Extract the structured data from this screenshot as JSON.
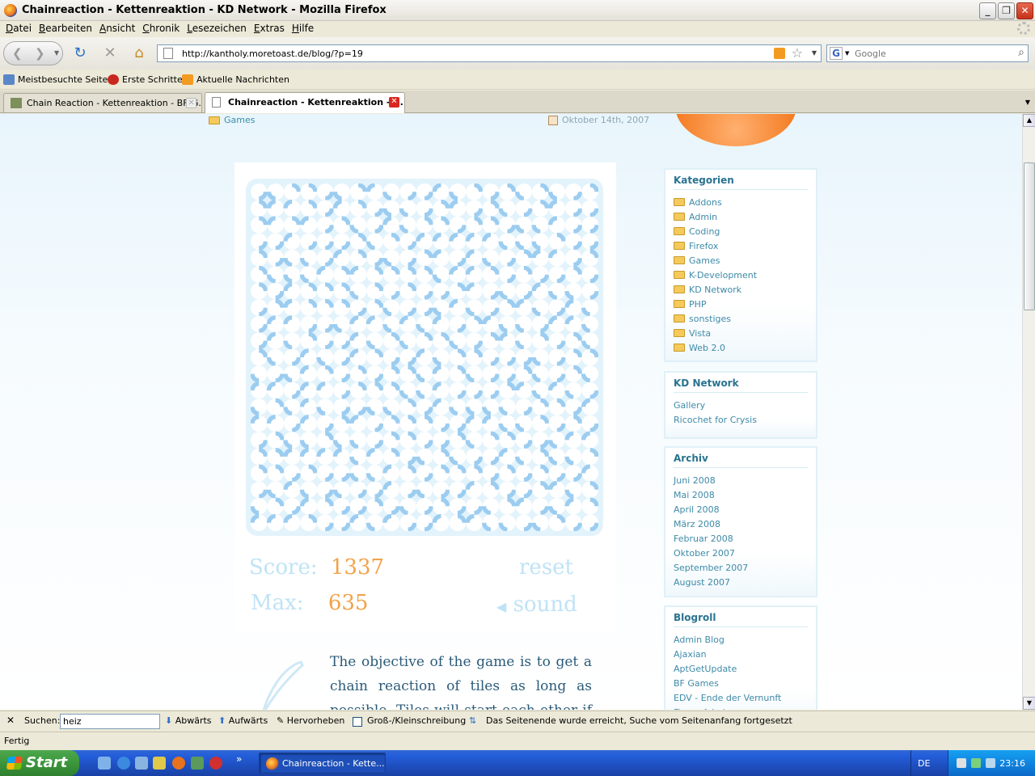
{
  "window": {
    "title": "Chainreaction - Kettenreaktion - KD Network - Mozilla Firefox"
  },
  "menu": [
    "Datei",
    "Bearbeiten",
    "Ansicht",
    "Chronik",
    "Lesezeichen",
    "Extras",
    "Hilfe"
  ],
  "nav": {
    "url": "http://kantholy.moretoast.de/blog/?p=19",
    "search_placeholder": "Google"
  },
  "bookmarks": [
    "Meistbesuchte Seiten",
    "Erste Schritte",
    "Aktuelle Nachrichten"
  ],
  "tabs": [
    {
      "label": "Chain Reaction - Kettenreaktion - BF-G...",
      "active": false
    },
    {
      "label": "Chainreaction - Kettenreaktion - ...",
      "active": true
    }
  ],
  "post": {
    "category": "Games",
    "date": "Oktober 14th, 2007"
  },
  "game": {
    "score_label": "Score:",
    "score_value": "1337",
    "max_label": "Max:",
    "max_value": "635",
    "reset_label": "reset",
    "sound_label": "sound",
    "grid_size": 21,
    "tile_color": "#9ccdf0"
  },
  "article": {
    "text": "The objective of the game is to get a chain reaction of tiles as long as possible. Tiles will start each other if their lines"
  },
  "sidebar": {
    "kategorien": {
      "title": "Kategorien",
      "items": [
        "Addons",
        "Admin",
        "Coding",
        "Firefox",
        "Games",
        "K-Development",
        "KD Network",
        "PHP",
        "sonstiges",
        "Vista",
        "Web 2.0"
      ]
    },
    "kdnetwork": {
      "title": "KD Network",
      "items": [
        "Gallery",
        "Ricochet for Crysis"
      ]
    },
    "archiv": {
      "title": "Archiv",
      "items": [
        "Juni 2008",
        "Mai 2008",
        "April 2008",
        "März 2008",
        "Februar 2008",
        "Oktober 2007",
        "September 2007",
        "August 2007"
      ]
    },
    "blogroll": {
      "title": "Blogroll",
      "items": [
        "Admin Blog",
        "Ajaxian",
        "AptGetUpdate",
        "BF Games",
        "EDV - Ende der Vernunft",
        "Fieser Admin"
      ]
    }
  },
  "findbar": {
    "label": "Suchen:",
    "value": "heiz",
    "down": "Abwärts",
    "up": "Aufwärts",
    "highlight": "Hervorheben",
    "case": "Groß-/Kleinschreibung",
    "message": "Das Seitenende wurde erreicht, Suche vom Seitenanfang fortgesetzt"
  },
  "status": "Fertig",
  "taskbar": {
    "start": "Start",
    "task": "Chainreaction - Kette...",
    "lang": "DE",
    "clock": "23:16"
  }
}
